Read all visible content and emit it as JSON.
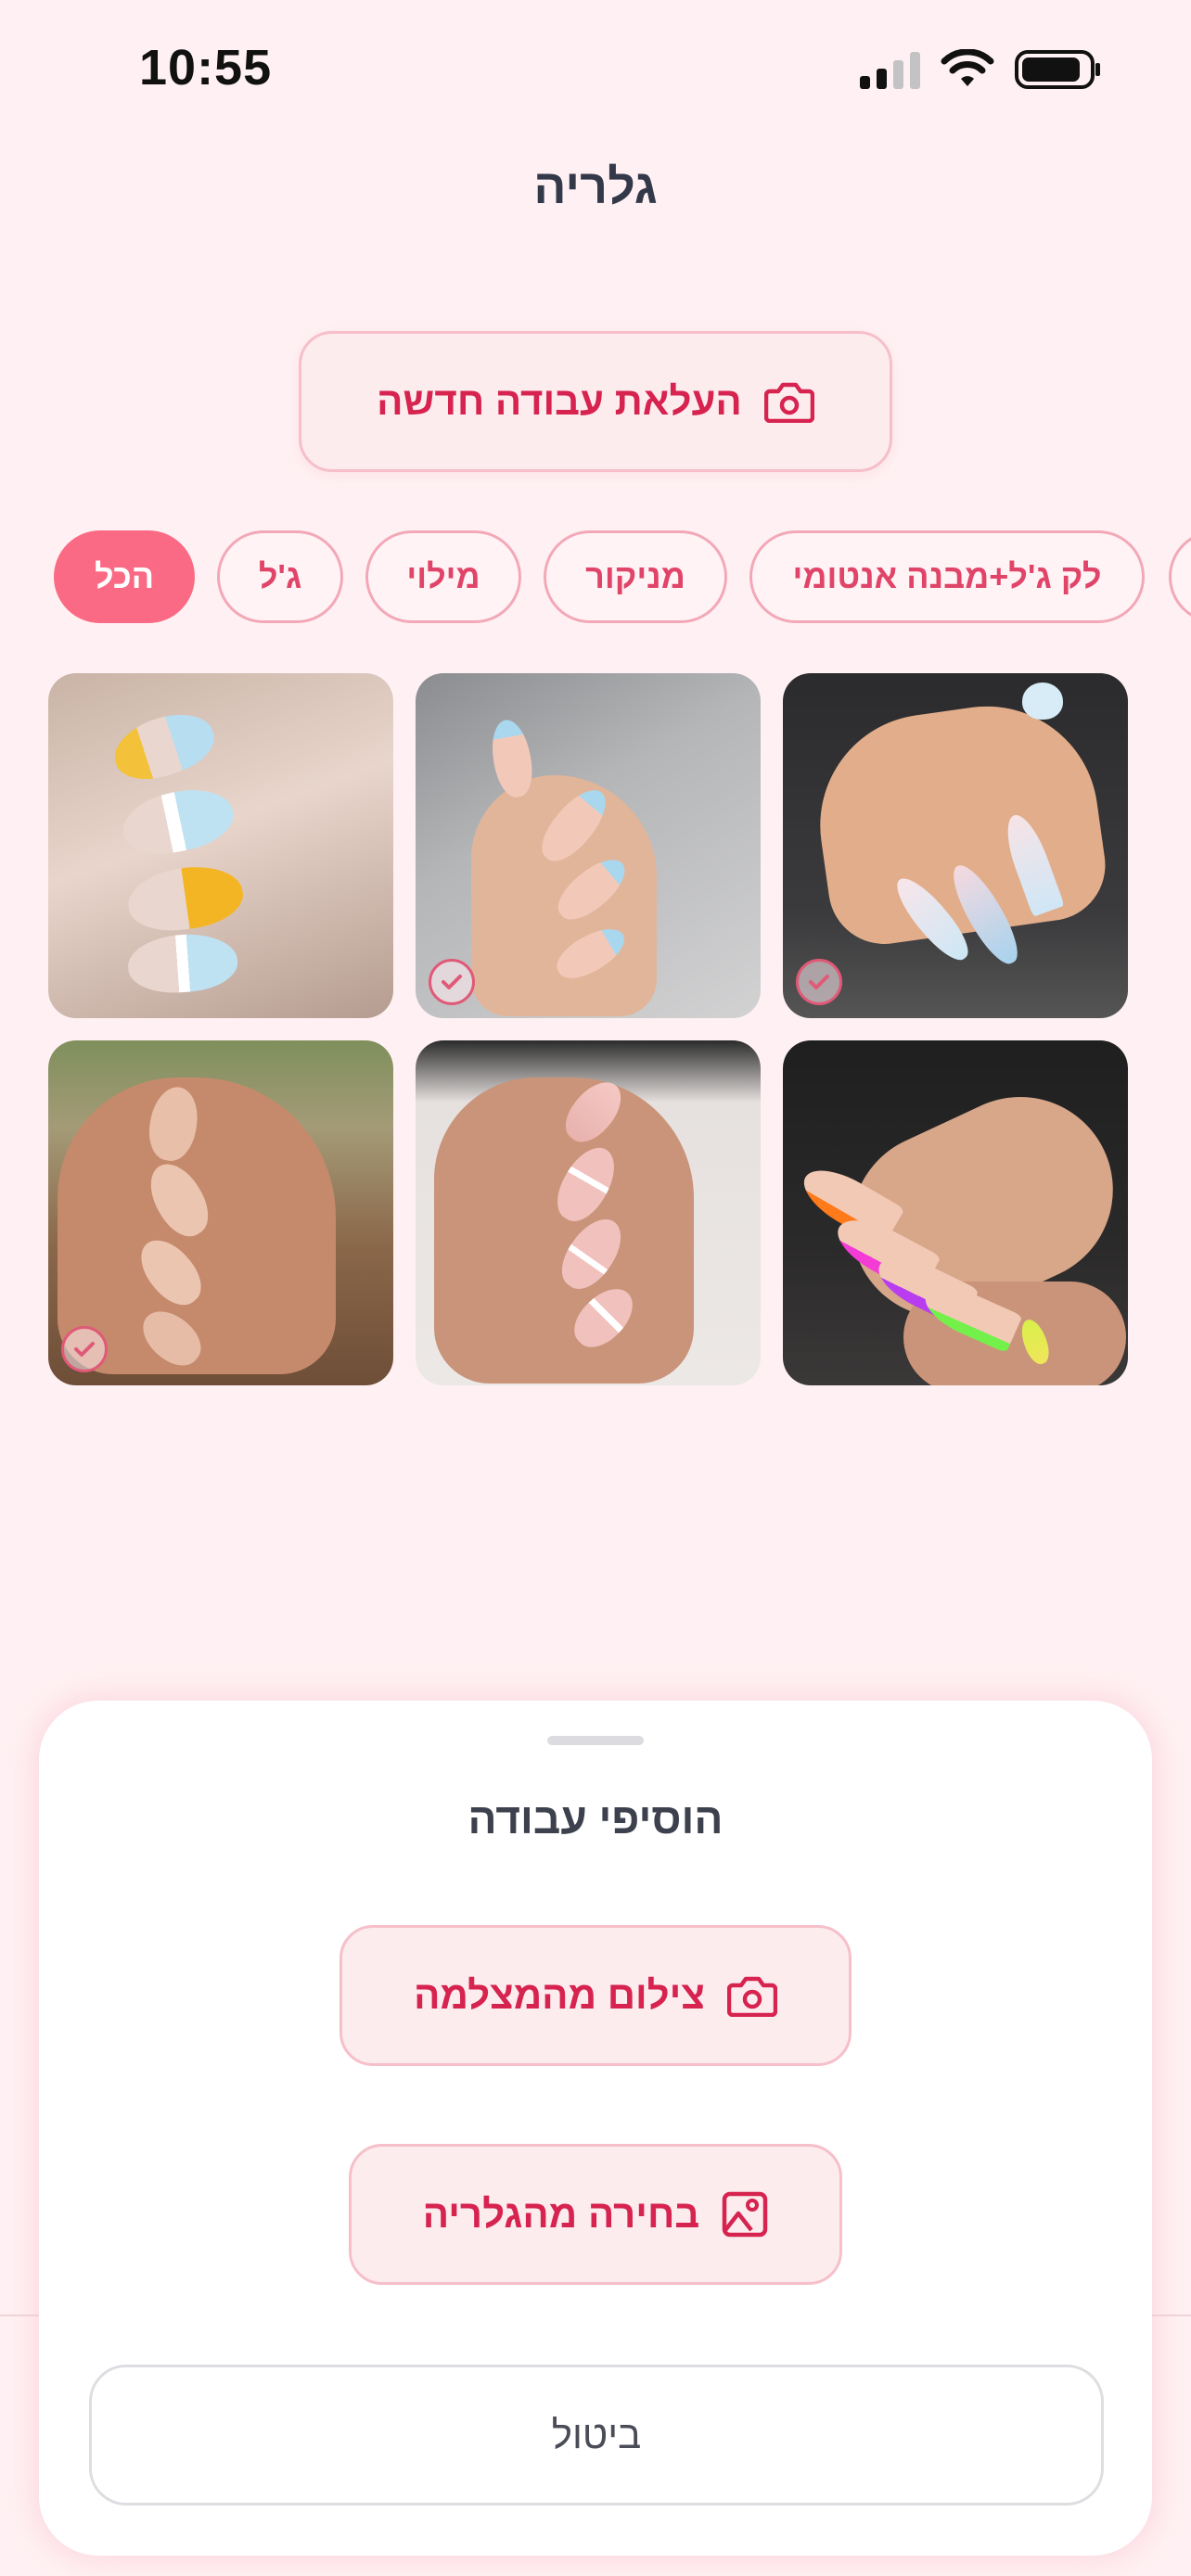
{
  "status_bar": {
    "time": "10:55"
  },
  "header": {
    "title": "גלריה"
  },
  "upload_button": {
    "label": "העלאת עבודה חדשה",
    "icon": "camera-icon"
  },
  "filters": {
    "items": [
      {
        "label": "הכל",
        "active": true
      },
      {
        "label": "ג'ל",
        "active": false
      },
      {
        "label": "מילוי",
        "active": false
      },
      {
        "label": "מניקור",
        "active": false
      },
      {
        "label": "לק ג'ל+מבנה אנטומי",
        "active": false
      }
    ]
  },
  "gallery": {
    "items": [
      {
        "alt": "nails-pastel-blue-stiletto",
        "selected": true
      },
      {
        "alt": "nails-blue-french-tips",
        "selected": true
      },
      {
        "alt": "nails-yellow-blue-swirl",
        "selected": false
      },
      {
        "alt": "nails-neon-french-tips",
        "selected": false
      },
      {
        "alt": "nails-white-wave-art",
        "selected": false
      },
      {
        "alt": "nails-nude-almond",
        "selected": true
      }
    ]
  },
  "sheet": {
    "title": "הוסיפי עבודה",
    "camera_button": {
      "label": "צילום מהמצלמה",
      "icon": "camera-icon"
    },
    "gallery_button": {
      "label": "בחירה מהגלריה",
      "icon": "image-icon"
    },
    "cancel_label": "ביטול"
  },
  "colors": {
    "accent": "#d6234f",
    "chip_active": "#fb6a84",
    "background": "#fff1f3"
  }
}
